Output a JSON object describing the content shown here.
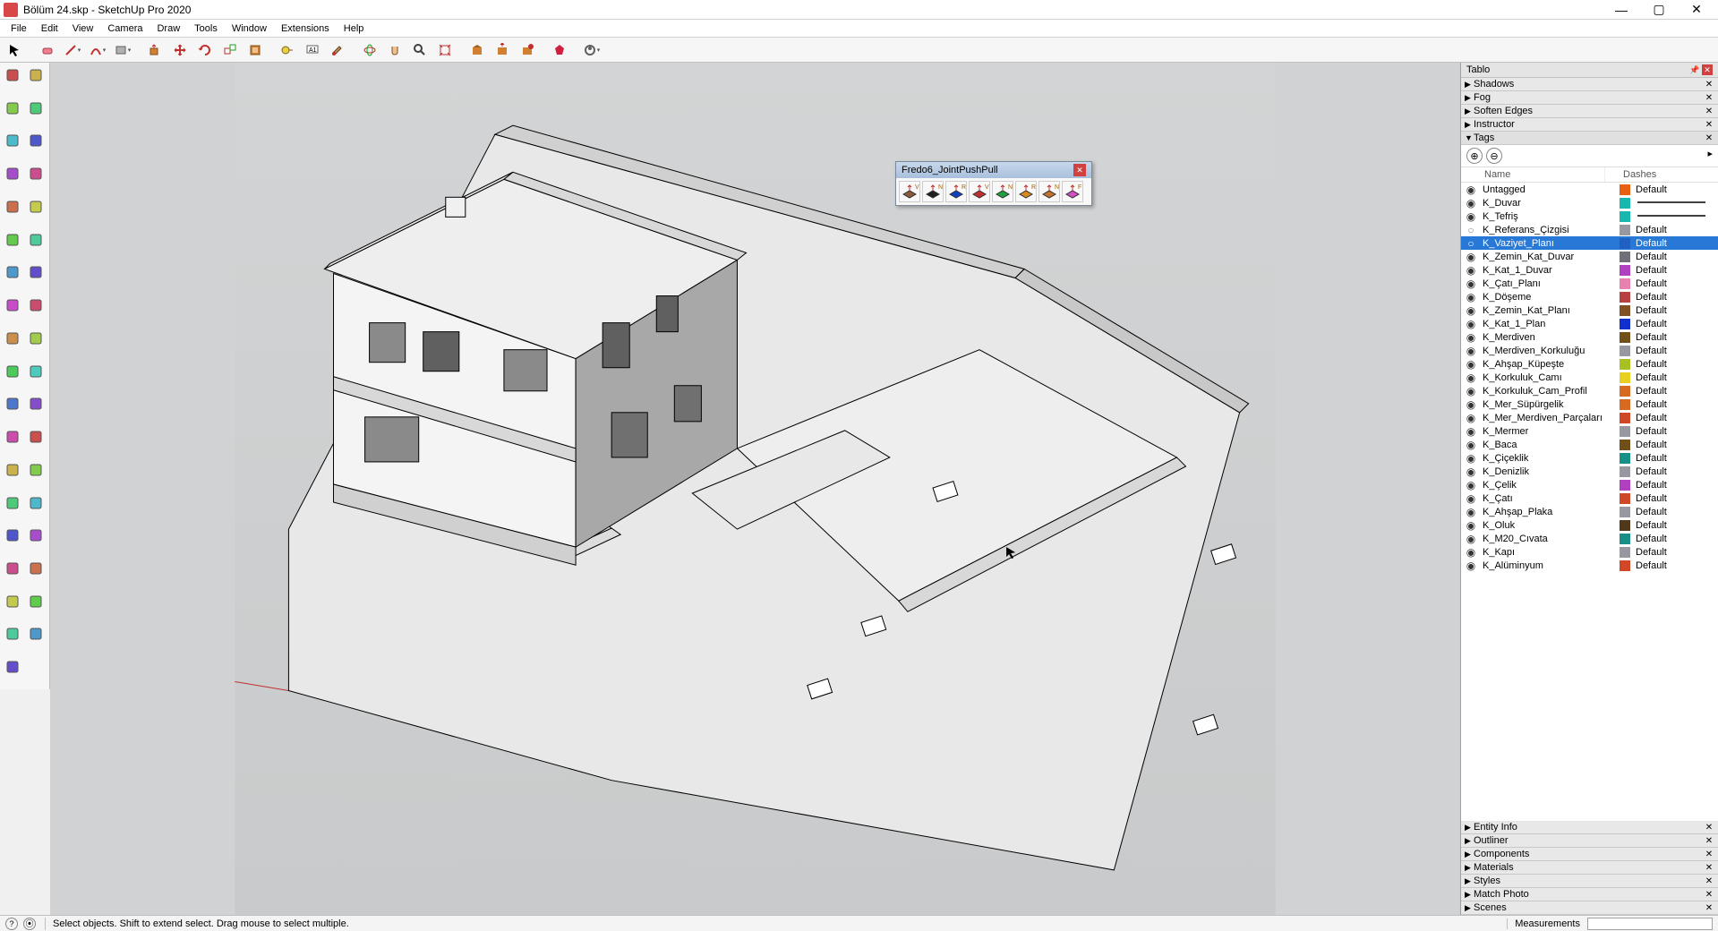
{
  "window": {
    "title": "Bölüm 24.skp - SketchUp Pro 2020",
    "min": "—",
    "max": "▢",
    "close": "✕"
  },
  "menu": [
    "File",
    "Edit",
    "View",
    "Camera",
    "Draw",
    "Tools",
    "Window",
    "Extensions",
    "Help"
  ],
  "top_tools": [
    "select",
    "eraser",
    "line",
    "arc",
    "rectangle",
    "pushpull",
    "move",
    "rotate",
    "scale",
    "offset",
    "tape",
    "text",
    "paint",
    "orbit",
    "pan",
    "zoom",
    "zoom-extents",
    "3dwarehouse",
    "ew-send",
    "ew-get",
    "ruby",
    "ext-mgr"
  ],
  "fredo": {
    "title": "Fredo6_JointPushPull",
    "buttons": [
      "jpp-1",
      "jpp-2",
      "jpp-3",
      "jpp-4",
      "jpp-5",
      "jpp-6",
      "jpp-7",
      "jpp-8"
    ],
    "colors": [
      "#8a5a3a",
      "#202020",
      "#1040c0",
      "#c03030",
      "#20a040",
      "#d48a20",
      "#c07030",
      "#d050c0"
    ],
    "letters": [
      "V",
      "N",
      "R",
      "V",
      "N",
      "R",
      "N",
      "F"
    ]
  },
  "tray": {
    "title": "Tablo",
    "panels_top": [
      "Shadows",
      "Fog",
      "Soften Edges",
      "Instructor"
    ],
    "tags_label": "Tags",
    "panels_bottom": [
      "Entity Info",
      "Outliner",
      "Components",
      "Materials",
      "Styles",
      "Match Photo",
      "Scenes"
    ],
    "col_name": "Name",
    "col_dash": "Dashes"
  },
  "tags": [
    {
      "vis": "on",
      "name": "Untagged",
      "color": "#e86010",
      "dash": "Default",
      "sel": false
    },
    {
      "vis": "on",
      "name": "K_Duvar",
      "color": "#18b8b0",
      "dash": "",
      "sel": false,
      "pattern": "solid"
    },
    {
      "vis": "on",
      "name": "K_Tefriş",
      "color": "#18b8b0",
      "dash": "",
      "sel": false,
      "pattern": "solid"
    },
    {
      "vis": "off",
      "name": "K_Referans_Çizgisi",
      "color": "#9898a0",
      "dash": "Default",
      "sel": false
    },
    {
      "vis": "off",
      "name": "K_Vaziyet_Planı",
      "color": "#2060c0",
      "dash": "Default",
      "sel": true
    },
    {
      "vis": "on",
      "name": "K_Zemin_Kat_Duvar",
      "color": "#707078",
      "dash": "Default",
      "sel": false
    },
    {
      "vis": "on",
      "name": "K_Kat_1_Duvar",
      "color": "#b040c0",
      "dash": "Default",
      "sel": false
    },
    {
      "vis": "on",
      "name": "K_Çatı_Planı",
      "color": "#e880b0",
      "dash": "Default",
      "sel": false
    },
    {
      "vis": "on",
      "name": "K_Döşeme",
      "color": "#b84040",
      "dash": "Default",
      "sel": false
    },
    {
      "vis": "on",
      "name": "K_Zemin_Kat_Planı",
      "color": "#805020",
      "dash": "Default",
      "sel": false
    },
    {
      "vis": "on",
      "name": "K_Kat_1_Plan",
      "color": "#1030d0",
      "dash": "Default",
      "sel": false
    },
    {
      "vis": "on",
      "name": "K_Merdiven",
      "color": "#705018",
      "dash": "Default",
      "sel": false
    },
    {
      "vis": "on",
      "name": "K_Merdiven_Korkuluğu",
      "color": "#9898a0",
      "dash": "Default",
      "sel": false
    },
    {
      "vis": "on",
      "name": "K_Ahşap_Küpeşte",
      "color": "#a8c020",
      "dash": "Default",
      "sel": false
    },
    {
      "vis": "on",
      "name": "K_Korkuluk_Camı",
      "color": "#e8d020",
      "dash": "Default",
      "sel": false
    },
    {
      "vis": "on",
      "name": "K_Korkuluk_Cam_Profil",
      "color": "#d86a20",
      "dash": "Default",
      "sel": false
    },
    {
      "vis": "on",
      "name": "K_Mer_Süpürgelik",
      "color": "#d86a20",
      "dash": "Default",
      "sel": false
    },
    {
      "vis": "on",
      "name": "K_Mer_Merdiven_Parçaları",
      "color": "#d04828",
      "dash": "Default",
      "sel": false
    },
    {
      "vis": "on",
      "name": "K_Mermer",
      "color": "#9898a0",
      "dash": "Default",
      "sel": false
    },
    {
      "vis": "on",
      "name": "K_Baca",
      "color": "#705018",
      "dash": "Default",
      "sel": false
    },
    {
      "vis": "on",
      "name": "K_Çiçeklik",
      "color": "#189088",
      "dash": "Default",
      "sel": false
    },
    {
      "vis": "on",
      "name": "K_Denizlik",
      "color": "#9898a0",
      "dash": "Default",
      "sel": false
    },
    {
      "vis": "on",
      "name": "K_Çelik",
      "color": "#b040c0",
      "dash": "Default",
      "sel": false
    },
    {
      "vis": "on",
      "name": "K_Çatı",
      "color": "#d04828",
      "dash": "Default",
      "sel": false
    },
    {
      "vis": "on",
      "name": "K_Ahşap_Plaka",
      "color": "#9898a0",
      "dash": "Default",
      "sel": false
    },
    {
      "vis": "on",
      "name": "K_Oluk",
      "color": "#503818",
      "dash": "Default",
      "sel": false
    },
    {
      "vis": "on",
      "name": "K_M20_Cıvata",
      "color": "#189088",
      "dash": "Default",
      "sel": false
    },
    {
      "vis": "on",
      "name": "K_Kapı",
      "color": "#9898a0",
      "dash": "Default",
      "sel": false
    },
    {
      "vis": "on",
      "name": "K_Alüminyum",
      "color": "#d04828",
      "dash": "Default",
      "sel": false
    }
  ],
  "status": {
    "hint": "Select objects. Shift to extend select. Drag mouse to select multiple.",
    "meas_label": "Measurements"
  }
}
